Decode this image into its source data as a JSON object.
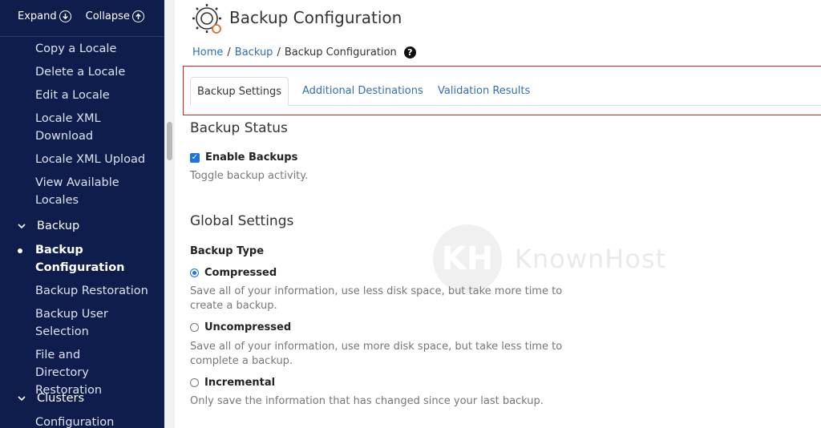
{
  "sidebar": {
    "expand_label": "Expand",
    "collapse_label": "Collapse",
    "items": [
      {
        "label": "Copy a Locale"
      },
      {
        "label": "Delete a Locale"
      },
      {
        "label": "Edit a Locale"
      },
      {
        "label": "Locale XML Download"
      },
      {
        "label": "Locale XML Upload"
      },
      {
        "label": "View Available Locales"
      }
    ],
    "backup_section": "Backup",
    "backup_items": [
      {
        "label": "Backup Configuration"
      },
      {
        "label": "Backup Restoration"
      },
      {
        "label": "Backup User Selection"
      },
      {
        "label": "File and Directory Restoration"
      }
    ],
    "clusters_section": "Clusters",
    "clusters_items": [
      {
        "label": "Configuration"
      }
    ]
  },
  "header": {
    "title": "Backup Configuration"
  },
  "breadcrumb": {
    "home": "Home",
    "backup": "Backup",
    "current": "Backup Configuration",
    "separator": "/"
  },
  "tabs": [
    {
      "label": "Backup Settings",
      "active": true
    },
    {
      "label": "Additional Destinations",
      "active": false
    },
    {
      "label": "Validation Results",
      "active": false
    }
  ],
  "backup_status": {
    "heading": "Backup Status",
    "enable_label": "Enable Backups",
    "enable_checked": true,
    "enable_help": "Toggle backup activity."
  },
  "global_settings": {
    "heading": "Global Settings",
    "backup_type_label": "Backup Type",
    "options": [
      {
        "label": "Compressed",
        "selected": true,
        "help": "Save all of your information, use less disk space, but take more time to create a backup."
      },
      {
        "label": "Uncompressed",
        "selected": false,
        "help": "Save all of your information, use more disk space, but take less time to complete a backup."
      },
      {
        "label": "Incremental",
        "selected": false,
        "help": "Only save the information that has changed since your last backup."
      }
    ]
  },
  "watermark": {
    "logo_text": "KH",
    "text": "KnownHost"
  },
  "colors": {
    "sidebar_bg": "#0f1d4d",
    "link": "#2f6fb7",
    "accent": "#1a73e8",
    "highlight_border": "#c62828"
  }
}
